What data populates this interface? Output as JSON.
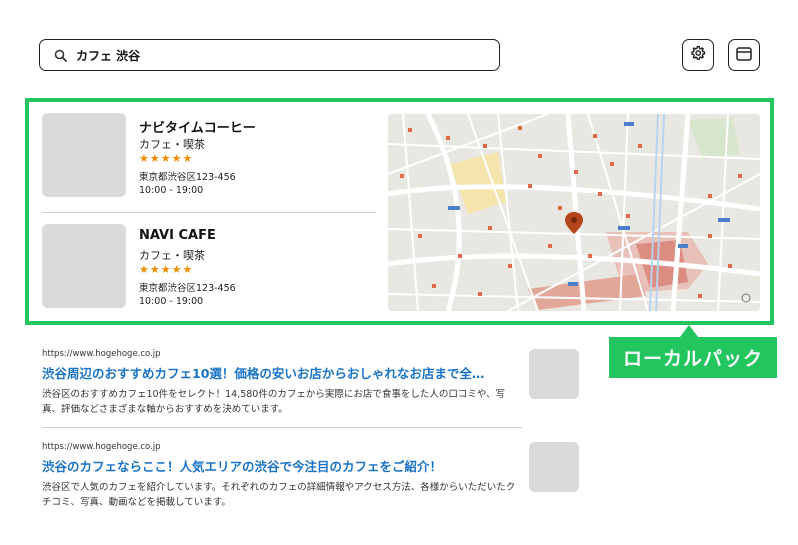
{
  "search": {
    "query": "カフェ 渋谷"
  },
  "toolbar": {
    "settings_icon": "gear-icon",
    "window_icon": "browser-window-icon"
  },
  "local_pack": {
    "label": "ローカルパック",
    "accent": "#22c55e",
    "businesses": [
      {
        "name": "ナビタイムコーヒー",
        "category": "カフェ・喫茶",
        "stars": "★★★★★",
        "rating": 5,
        "address": "東京都渋谷区123-456",
        "hours": "10:00 - 19:00"
      },
      {
        "name": "NAVI CAFE",
        "category": "カフェ・喫茶",
        "stars": "★★★★★",
        "rating": 5,
        "address": "東京都渋谷区123-456",
        "hours": "10:00 - 19:00"
      }
    ],
    "map": {
      "marker_icon": "map-pin-icon"
    }
  },
  "results": [
    {
      "url": "https://www.hogehoge.co.jp",
      "title": "渋谷周辺のおすすめカフェ10選！価格の安いお店からおしゃれなお店まで全…",
      "snippet": "渋谷区のおすすめカフェ10件をセレクト！14,580件のカフェから実際にお店で食事をした人の口コミや、写真、評価などさまざまな軸からおすすめを決めています。"
    },
    {
      "url": "https://www.hogehoge.co.jp",
      "title": "渋谷のカフェならここ！人気エリアの渋谷で今注目のカフェをご紹介！",
      "snippet": "渋谷区で人気のカフェを紹介しています。それぞれのカフェの詳細情報やアクセス方法、各様からいただいたクチコミ、写真、動画などを掲載しています。"
    }
  ],
  "colors": {
    "link": "#1a73c8",
    "star": "#f08c00",
    "placeholder": "#d9d9d9"
  }
}
